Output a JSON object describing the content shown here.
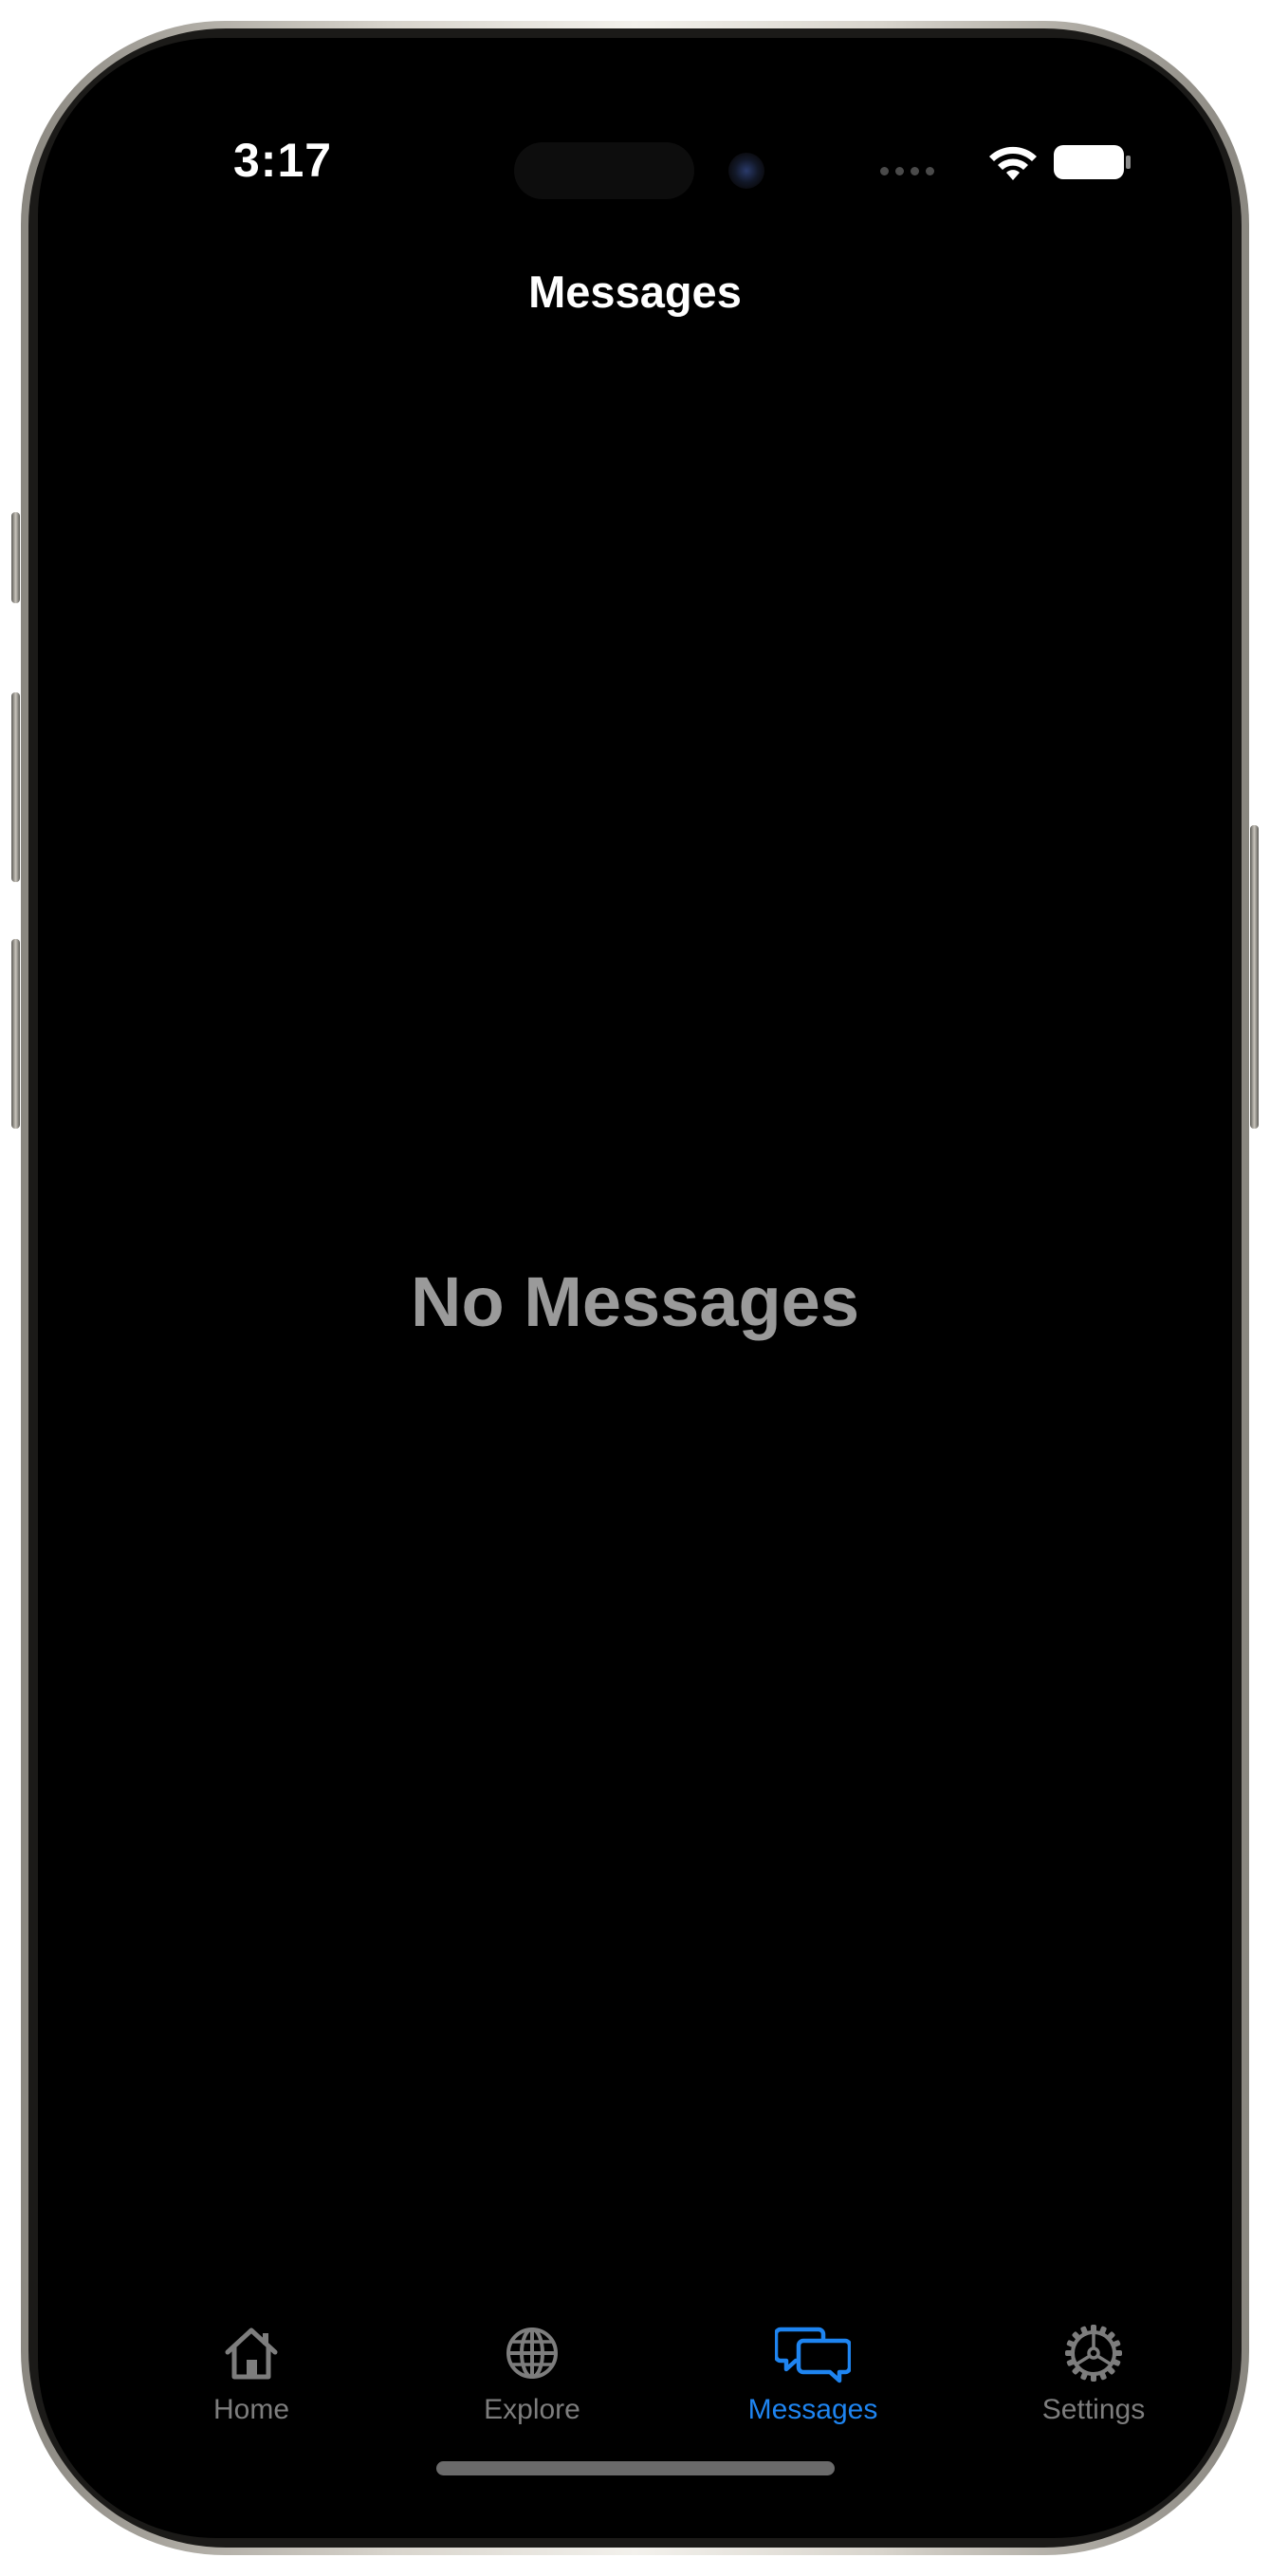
{
  "status_bar": {
    "time": "3:17"
  },
  "nav": {
    "title": "Messages"
  },
  "main": {
    "empty_state": "No Messages"
  },
  "tab_bar": {
    "tabs": [
      {
        "label": "Home",
        "icon": "house-icon",
        "active": false
      },
      {
        "label": "Explore",
        "icon": "globe-icon",
        "active": false
      },
      {
        "label": "Messages",
        "icon": "chat-bubbles-icon",
        "active": true
      },
      {
        "label": "Settings",
        "icon": "gear-icon",
        "active": false
      }
    ]
  },
  "colors": {
    "background": "#000000",
    "accent": "#1e84f0",
    "inactive": "#7d7d7d",
    "empty_text": "#9a9a9a"
  }
}
